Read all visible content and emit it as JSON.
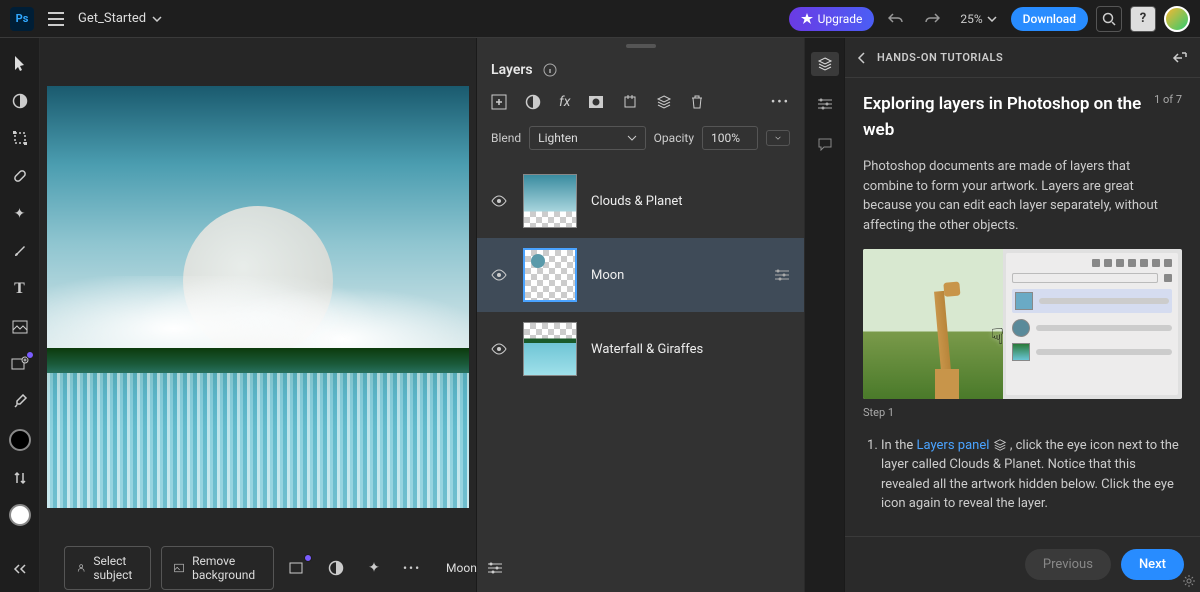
{
  "header": {
    "doc_name": "Get_Started",
    "upgrade": "Upgrade",
    "zoom": "25%",
    "download": "Download"
  },
  "canvas_toolbar": {
    "select_subject": "Select subject",
    "remove_bg": "Remove background",
    "layer_label": "Moon"
  },
  "layers_panel": {
    "title": "Layers",
    "blend_label": "Blend",
    "blend_value": "Lighten",
    "opacity_label": "Opacity",
    "opacity_value": "100%",
    "layers": [
      {
        "name": "Clouds & Planet",
        "selected": false
      },
      {
        "name": "Moon",
        "selected": true
      },
      {
        "name": "Waterfall & Giraffes",
        "selected": false
      }
    ]
  },
  "tutorial": {
    "crumb": "HANDS-ON TUTORIALS",
    "title": "Exploring layers in Photoshop on the web",
    "step_count": "1 of 7",
    "description": "Photoshop documents are made of layers that combine to form your artwork. Layers are great because you can edit each layer separately, without affecting the other objects.",
    "step_label": "Step 1",
    "step_prefix": "In the ",
    "step_link": "Layers panel",
    "step_suffix": " , click the eye icon next to the layer called Clouds & Planet. Notice that this revealed all the artwork hidden below. Click the eye icon again to reveal the layer.",
    "prev": "Previous",
    "next": "Next"
  }
}
